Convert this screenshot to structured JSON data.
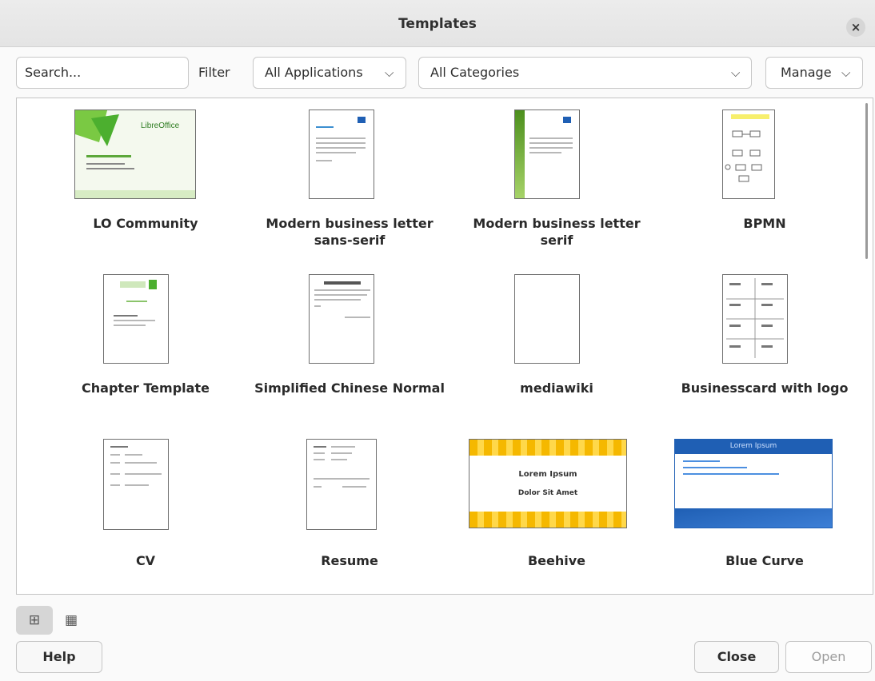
{
  "window": {
    "title": "Templates",
    "close_icon": "×"
  },
  "toolbar": {
    "search_placeholder": "Search...",
    "filter_label": "Filter",
    "applications_value": "All Applications",
    "categories_value": "All Categories",
    "manage_label": "Manage"
  },
  "templates": [
    {
      "name": "LO Community",
      "thumb_text": "LibreOffice"
    },
    {
      "name": "Modern business letter sans-serif"
    },
    {
      "name": "Modern business letter serif"
    },
    {
      "name": "BPMN"
    },
    {
      "name": "Chapter Template"
    },
    {
      "name": "Simplified Chinese Normal"
    },
    {
      "name": "mediawiki"
    },
    {
      "name": "Businesscard with logo"
    },
    {
      "name": "CV"
    },
    {
      "name": "Resume"
    },
    {
      "name": "Beehive",
      "thumb_text": [
        "Lorem Ipsum",
        "Dolor Sit Amet"
      ]
    },
    {
      "name": "Blue Curve",
      "thumb_text": [
        "Lorem Ipsum"
      ]
    }
  ],
  "view_buttons": {
    "grid_icon": "⊞",
    "list_icon": "▦"
  },
  "buttons": {
    "help": "Help",
    "close": "Close",
    "open": "Open"
  },
  "colors": {
    "accent_blue": "#1f5fb4",
    "beehive_yellow": "#f5b800",
    "lo_green": "#4caf2f"
  }
}
